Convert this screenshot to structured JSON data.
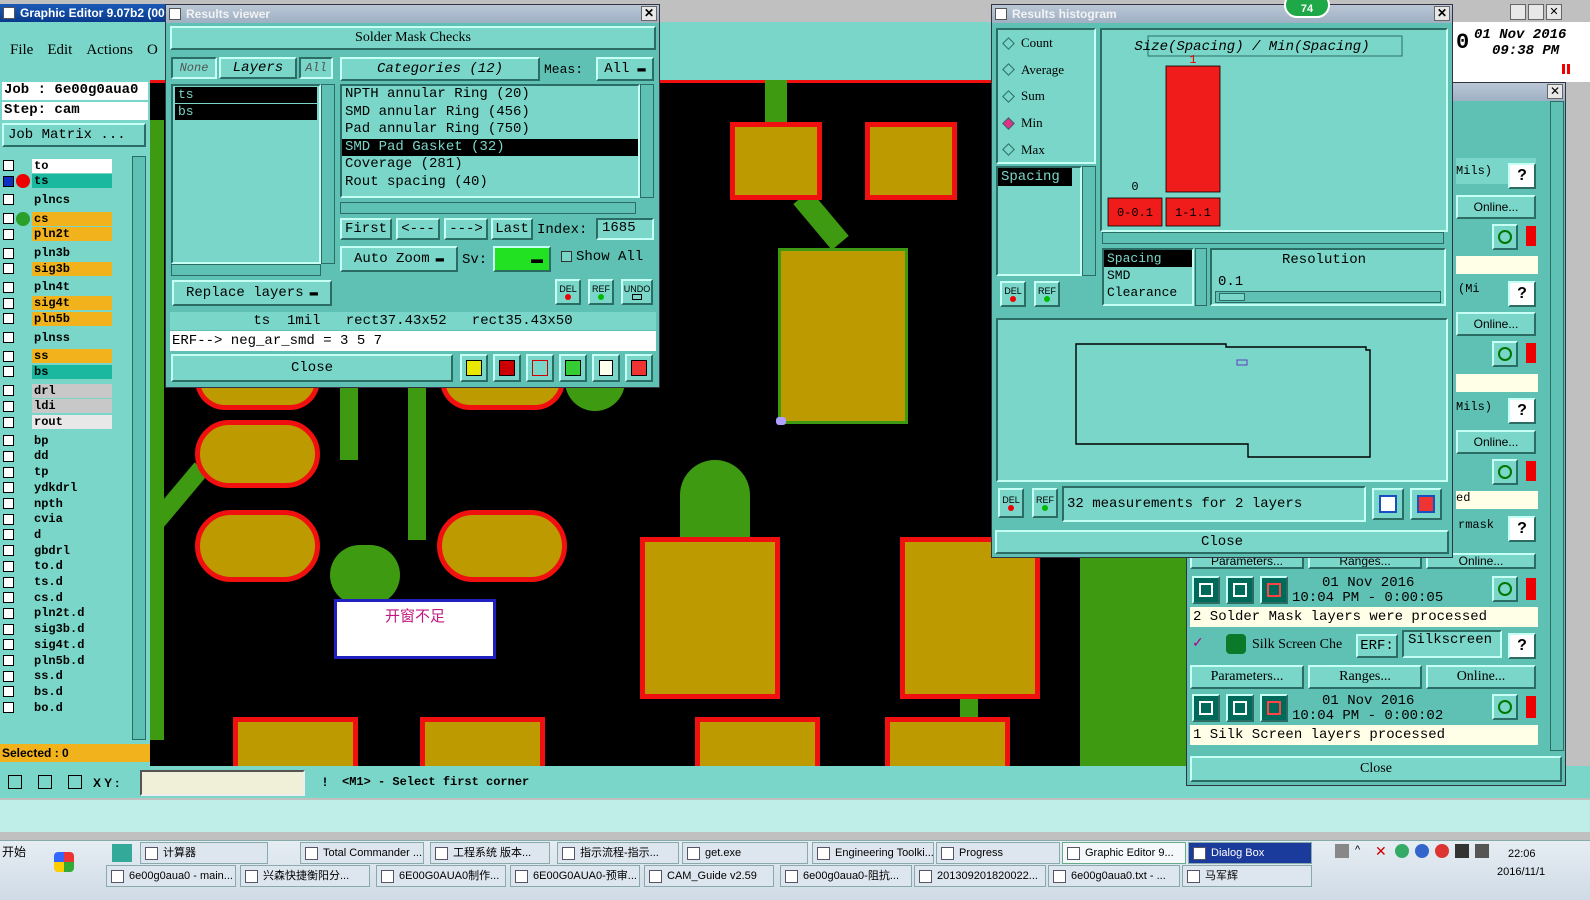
{
  "app": {
    "title": "Graphic Editor 9.07b2 (00",
    "menu": [
      "File",
      "Edit",
      "Actions",
      "O"
    ],
    "job_label": "Job :",
    "job_value": "6e00g0aua0",
    "step_label": "Step:",
    "step_value": "cam",
    "job_matrix": "Job Matrix ...",
    "date_line1": "01 Nov 2016",
    "date_line2": "09:38 PM",
    "date_prefix": "0",
    "layers": [
      {
        "name": "to",
        "color": "#ffffff"
      },
      {
        "name": "ts",
        "color": "#1ab89f"
      },
      {
        "name": "plncs",
        "color": "#79d6c8"
      },
      {
        "name": "cs",
        "color": "#f2b21b"
      },
      {
        "name": "pln2t",
        "color": "#f2b21b"
      },
      {
        "name": "pln3b",
        "color": "#79d6c8"
      },
      {
        "name": "sig3b",
        "color": "#f2b21b"
      },
      {
        "name": "pln4t",
        "color": "#79d6c8"
      },
      {
        "name": "sig4t",
        "color": "#f2b21b"
      },
      {
        "name": "pln5b",
        "color": "#f2b21b"
      },
      {
        "name": "plnss",
        "color": "#79d6c8"
      },
      {
        "name": "ss",
        "color": "#f2b21b"
      },
      {
        "name": "bs",
        "color": "#1ab89f"
      },
      {
        "name": "drl",
        "color": "#c8c8c8"
      },
      {
        "name": "ldi",
        "color": "#c8c8c8"
      },
      {
        "name": "rout",
        "color": "#e8e8e8"
      },
      {
        "name": "bp",
        "color": "#79d6c8"
      },
      {
        "name": "dd",
        "color": "#79d6c8"
      },
      {
        "name": "tp",
        "color": "#79d6c8"
      },
      {
        "name": "ydkdrl",
        "color": "#79d6c8"
      },
      {
        "name": "npth",
        "color": "#79d6c8"
      },
      {
        "name": "cvia",
        "color": "#79d6c8"
      },
      {
        "name": "d",
        "color": "#79d6c8"
      },
      {
        "name": "gbdrl",
        "color": "#79d6c8"
      },
      {
        "name": "to.d",
        "color": "#79d6c8"
      },
      {
        "name": "ts.d",
        "color": "#79d6c8"
      },
      {
        "name": "cs.d",
        "color": "#79d6c8"
      },
      {
        "name": "pln2t.d",
        "color": "#79d6c8"
      },
      {
        "name": "sig3b.d",
        "color": "#79d6c8"
      },
      {
        "name": "sig4t.d",
        "color": "#79d6c8"
      },
      {
        "name": "pln5b.d",
        "color": "#79d6c8"
      },
      {
        "name": "ss.d",
        "color": "#79d6c8"
      },
      {
        "name": "bs.d",
        "color": "#79d6c8"
      },
      {
        "name": "bo.d",
        "color": "#79d6c8"
      }
    ],
    "selected": "Selected :  0",
    "xy_label": "X Y :",
    "status_msg": "<M1> - Select first corner",
    "annotation": "开窗不足"
  },
  "results_viewer": {
    "title": "Results viewer",
    "header": "Solder Mask Checks",
    "none_btn": "None",
    "layers_btn": "Layers",
    "all_btn": "All",
    "categories": "Categories (12)",
    "meas_label": "Meas:",
    "meas_value": "All",
    "layer_list": [
      "ts",
      "bs"
    ],
    "category_list": [
      "NPTH annular Ring (20)",
      "SMD annular Ring (456)",
      "Pad annular Ring (750)",
      "SMD Pad Gasket (32)",
      "Coverage (281)",
      "Rout spacing (40)"
    ],
    "first": "First",
    "prev": "<---",
    "next": "--->",
    "last": "Last",
    "index_label": "Index:",
    "index_value": "1685",
    "auto_zoom": "Auto Zoom",
    "sv_label": "Sv:",
    "show_all": "Show All",
    "replace_layers": "Replace layers",
    "del": "DEL",
    "ref": "REF",
    "undo": "UNDO",
    "info_line": "ts  1mil   rect37.43x52   rect35.43x50",
    "erf_line": "ERF--> neg_ar_smd = 3 5 7",
    "close": "Close"
  },
  "histogram": {
    "title": "Results histogram",
    "badge": "74",
    "stats": [
      {
        "label": "Count",
        "selected": false
      },
      {
        "label": "Average",
        "selected": false
      },
      {
        "label": "Sum",
        "selected": false
      },
      {
        "label": "Min",
        "selected": true
      },
      {
        "label": "Max",
        "selected": false
      }
    ],
    "metric_list": [
      "Spacing"
    ],
    "param_list": [
      "Spacing",
      "SMD",
      "Clearance"
    ],
    "resolution_label": "Resolution",
    "resolution_value": "0.1",
    "summary": "32 measurements for 2 layers",
    "del": "DEL",
    "ref": "REF",
    "close": "Close"
  },
  "chart_data": {
    "type": "bar",
    "title": "Size(Spacing) / Min(Spacing)",
    "categories": [
      "0-0.1",
      "1-1.1"
    ],
    "values": [
      0,
      1
    ],
    "data_labels": [
      "0",
      "1"
    ],
    "bar_color": "#f01c1c"
  },
  "checks_panel": {
    "items": [
      "Mils)",
      "Online...",
      "(Mi",
      "Online...",
      "Mils)",
      "Online...",
      "ed",
      "rmask"
    ],
    "help": "?",
    "params": "Parameters...",
    "ranges": "Ranges...",
    "online": "Online...",
    "solder_date": "01 Nov 2016",
    "solder_time": "10:04 PM - 0:00:05",
    "solder_msg": "2 Solder Mask layers were processed",
    "silk_name": "Silk Screen Che",
    "erf_label": "ERF:",
    "silk_erf": "Silkscreen",
    "silk_date": "01 Nov 2016",
    "silk_time": "10:04 PM - 0:00:02",
    "silk_msg": "1 Silk Screen layers processed",
    "close": "Close"
  },
  "taskbar": {
    "start": "开始",
    "row1": [
      "计算器",
      "Total Commander ...",
      "工程系统  版本...",
      "指示流程-指示...",
      "get.exe",
      "Engineering Toolki...",
      "Progress",
      "Graphic Editor 9...",
      "Dialog Box"
    ],
    "row2": [
      "6e00g0aua0 - main...",
      "兴森快捷衡阳分...",
      "6E00G0AUA0制作...",
      "6E00G0AUA0-预审...",
      "CAM_Guide v2.59",
      "6e00g0aua0-阻抗...",
      "201309201820022...",
      "6e00g0aua0.txt - ...",
      "马军辉"
    ],
    "clock_time": "22:06",
    "clock_date": "2016/11/1"
  }
}
